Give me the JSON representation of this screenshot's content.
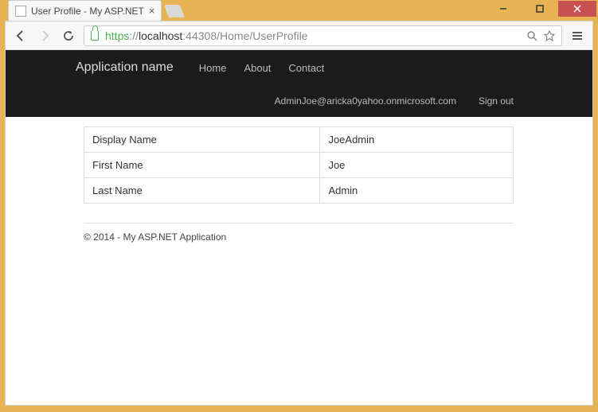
{
  "tab": {
    "title": "User Profile - My ASP.NET"
  },
  "url": {
    "scheme": "https",
    "host": "localhost",
    "port": ":44308",
    "path": "/Home/UserProfile"
  },
  "navbar": {
    "brand": "Application name",
    "links": {
      "home": "Home",
      "about": "About",
      "contact": "Contact"
    },
    "user": "AdminJoe@aricka0yahoo.onmicrosoft.com",
    "signout": "Sign out"
  },
  "profile": {
    "fields": [
      {
        "label": "Display Name",
        "value": "JoeAdmin"
      },
      {
        "label": "First Name",
        "value": "Joe"
      },
      {
        "label": "Last Name",
        "value": "Admin"
      }
    ]
  },
  "footer": "© 2014 - My ASP.NET Application"
}
